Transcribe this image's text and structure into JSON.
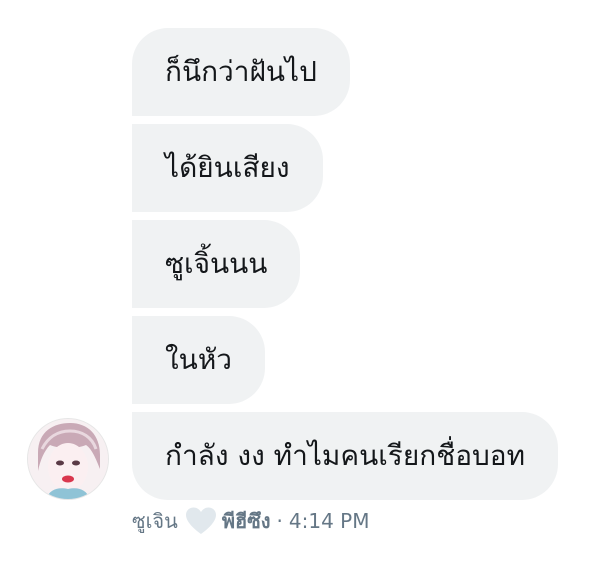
{
  "messages": [
    {
      "text": "ก็นึกว่าฝันไป"
    },
    {
      "text": "ได้ยินเสียง"
    },
    {
      "text": "ซูเจิ้นนน"
    },
    {
      "text": "ในหัว"
    },
    {
      "text": "กำลัง งง ทำไมคนเรียกชื่อบอท"
    }
  ],
  "meta": {
    "sender_name": "ซูเจิน",
    "reaction_icon": "heart-icon",
    "reactor_name": "พีฮีซึง",
    "separator": "·",
    "time": "4:14 PM"
  },
  "colors": {
    "bubble": "#f0f2f3",
    "text": "#14171a",
    "meta_text": "#657786",
    "heart": "#e1e8ed"
  }
}
